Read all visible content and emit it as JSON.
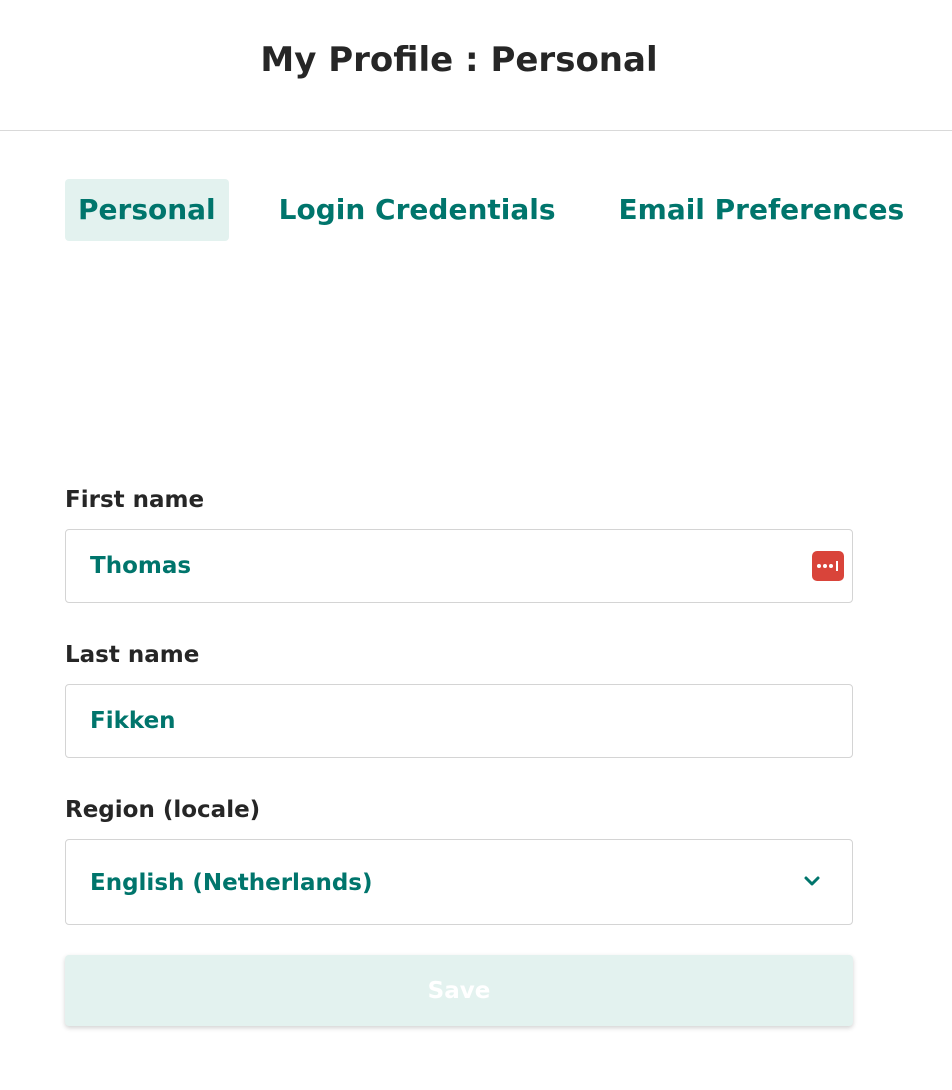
{
  "header": {
    "title": "My Profile : Personal"
  },
  "tabs": [
    {
      "label": "Personal",
      "active": true
    },
    {
      "label": "Login Credentials",
      "active": false
    },
    {
      "label": "Email Preferences",
      "active": false
    }
  ],
  "form": {
    "first_name": {
      "label": "First name",
      "value": "Thomas"
    },
    "last_name": {
      "label": "Last name",
      "value": "Fikken"
    },
    "region": {
      "label": "Region (locale)",
      "value": "English (Netherlands)"
    }
  },
  "actions": {
    "save_label": "Save",
    "save_disabled": true
  },
  "icons": {
    "password_manager": "password-manager-icon",
    "dropdown": "chevron-down-icon"
  },
  "colors": {
    "accent": "#00756c",
    "tab_active_bg": "#e3f2ef",
    "password_icon_bg": "#d9443a",
    "text": "#262626"
  }
}
